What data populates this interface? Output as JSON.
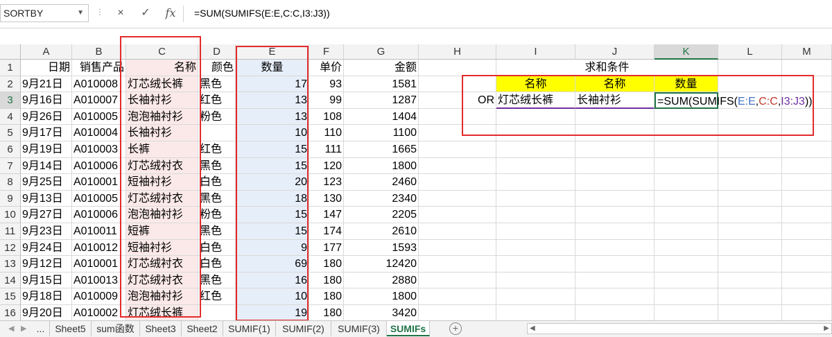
{
  "formula_bar": {
    "name_box": "SORTBY",
    "cancel_icon": "×",
    "enter_icon": "✓",
    "fx_label": "fx",
    "formula": "=SUM(SUMIFS(E:E,C:C,I3:J3))"
  },
  "columns": [
    "A",
    "B",
    "C",
    "D",
    "E",
    "F",
    "G",
    "H",
    "I",
    "J",
    "K",
    "L",
    "M"
  ],
  "headers": [
    "日期",
    "销售产品",
    "名称",
    "颜色",
    "数量",
    "单价",
    "金额"
  ],
  "rows": [
    [
      "9月21日",
      "A010008",
      "灯芯绒长裤",
      "黑色",
      "17",
      "93",
      "1581"
    ],
    [
      "9月16日",
      "A010007",
      "长袖衬衫",
      "红色",
      "13",
      "99",
      "1287"
    ],
    [
      "9月26日",
      "A010005",
      "泡泡袖衬衫",
      "粉色",
      "13",
      "108",
      "1404"
    ],
    [
      "9月17日",
      "A010004",
      "长袖衬衫",
      "",
      "10",
      "110",
      "1100"
    ],
    [
      "9月19日",
      "A010003",
      "长裤",
      "红色",
      "15",
      "111",
      "1665"
    ],
    [
      "9月14日",
      "A010006",
      "灯芯绒衬衣",
      "黑色",
      "15",
      "120",
      "1800"
    ],
    [
      "9月25日",
      "A010001",
      "短袖衬衫",
      "白色",
      "20",
      "123",
      "2460"
    ],
    [
      "9月13日",
      "A010005",
      "灯芯绒衬衣",
      "黑色",
      "18",
      "130",
      "2340"
    ],
    [
      "9月27日",
      "A010006",
      "泡泡袖衬衫",
      "粉色",
      "15",
      "147",
      "2205"
    ],
    [
      "9月23日",
      "A010011",
      "短裤",
      "黑色",
      "15",
      "174",
      "2610"
    ],
    [
      "9月24日",
      "A010012",
      "短袖衬衫",
      "白色",
      "9",
      "177",
      "1593"
    ],
    [
      "9月12日",
      "A010001",
      "灯芯绒衬衣",
      "白色",
      "69",
      "180",
      "12420"
    ],
    [
      "9月15日",
      "A010013",
      "灯芯绒衬衣",
      "黑色",
      "16",
      "180",
      "2880"
    ],
    [
      "9月18日",
      "A010009",
      "泡泡袖衬衫",
      "红色",
      "10",
      "180",
      "1800"
    ],
    [
      "9月20日",
      "A010002",
      "灯芯绒长裤",
      "",
      "19",
      "180",
      "3420"
    ]
  ],
  "criteria": {
    "title": "求和条件",
    "header_name1": "名称",
    "header_name2": "名称",
    "header_qty": "数量",
    "or_label": "OR",
    "value1": "灯芯绒长裤",
    "value2": "长袖衬衫",
    "formula_prefix": "=SUM(SUMIFS(",
    "ref_e": "E:E",
    "comma1": ",",
    "ref_c": "C:C",
    "comma2": ",",
    "ref_ij": "I3:J3",
    "formula_suffix": "))"
  },
  "sheet_tabs": [
    "...",
    "Sheet5",
    "sum函数",
    "Sheet3",
    "Sheet2",
    "SUMIF(1)",
    "SUMIF(2)",
    "SUMIF(3)",
    "SUMIFs"
  ],
  "active_tab": "SUMIFs",
  "colors": {
    "accent": "#217346",
    "highlight_red": "#e32b2b",
    "ref_blue": "#4472c4",
    "ref_red": "#c0392b",
    "ref_purple": "#7030a0"
  }
}
